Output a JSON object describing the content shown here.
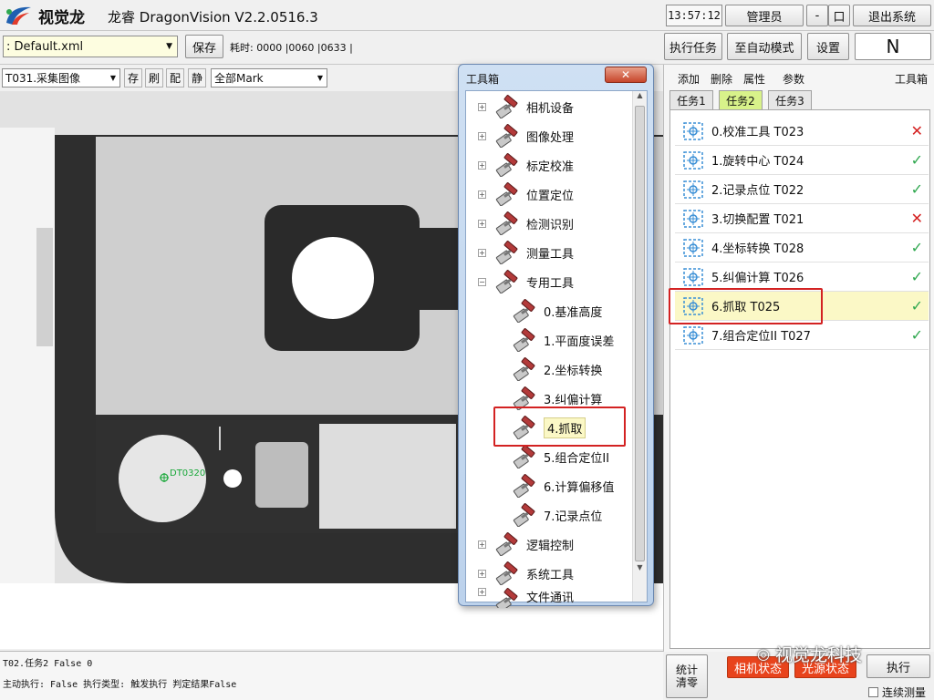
{
  "logo": {
    "text": "视觉龙"
  },
  "title": "龙睿 DragonVision V2.2.0516.3",
  "clock": "13:57:12",
  "user_label": "管理员",
  "min_label": "-",
  "max_label": "口",
  "exit_label": "退出系统",
  "file_select": ": Default.xml",
  "save_label": "保存",
  "timing_text": "耗时: 0000 |0060 |0633 |",
  "run_task_label": "执行任务",
  "auto_mode_label": "至自动模式",
  "settings_label": "设置",
  "mode_indicator": "N",
  "image_toolbar": {
    "task_select": "T031.采集图像",
    "store": "存",
    "refresh": "刷",
    "match": "配",
    "still": "静",
    "mark_select": "全部Mark"
  },
  "image_overlay": {
    "marker_label": "DT0320"
  },
  "toolbox": {
    "title": "工具箱",
    "categories": [
      {
        "label": "相机设备"
      },
      {
        "label": "图像处理"
      },
      {
        "label": "标定校准"
      },
      {
        "label": "位置定位"
      },
      {
        "label": "检测识别"
      },
      {
        "label": "测量工具"
      },
      {
        "label": "专用工具"
      }
    ],
    "children": [
      {
        "label": "0.基准高度"
      },
      {
        "label": "1.平面度误差"
      },
      {
        "label": "2.坐标转换"
      },
      {
        "label": "3.纠偏计算"
      },
      {
        "label": "4.抓取"
      },
      {
        "label": "5.组合定位II"
      },
      {
        "label": "6.计算偏移值"
      },
      {
        "label": "7.记录点位"
      }
    ],
    "bottom_categories": [
      {
        "label": "逻辑控制"
      },
      {
        "label": "系统工具"
      },
      {
        "label": "文件通讯"
      }
    ]
  },
  "right_panel": {
    "menu": {
      "add": "添加",
      "delete": "删除",
      "props": "属性",
      "params": "参数",
      "toolbox": "工具箱"
    },
    "tabs": [
      {
        "label": "任务1"
      },
      {
        "label": "任务2"
      },
      {
        "label": "任务3"
      }
    ],
    "tasks": [
      {
        "label": "0.校准工具 T023",
        "status": "fail"
      },
      {
        "label": "1.旋转中心 T024",
        "status": "ok"
      },
      {
        "label": "2.记录点位 T022",
        "status": "ok"
      },
      {
        "label": "3.切换配置 T021",
        "status": "fail"
      },
      {
        "label": "4.坐标转换 T028",
        "status": "ok"
      },
      {
        "label": "5.纠偏计算 T026",
        "status": "ok"
      },
      {
        "label": "6.抓取 T025",
        "status": "ok"
      },
      {
        "label": "7.组合定位II T027",
        "status": "ok"
      }
    ]
  },
  "status_log": {
    "line1": "T02.任务2  False 0",
    "line2": "主动执行: False 执行类型: 触发执行  判定结果False"
  },
  "bottom_buttons": {
    "stats_clear": "统计\n清零",
    "camera": "相机状态",
    "light": "光源状态",
    "execute": "执行",
    "continuous": "连续测量"
  },
  "watermark": "视觉龙科技",
  "colors": {
    "ok": "#2fa84f",
    "fail": "#d42020",
    "highlight": "#d32222",
    "accent_tab": "#d8f28a"
  }
}
